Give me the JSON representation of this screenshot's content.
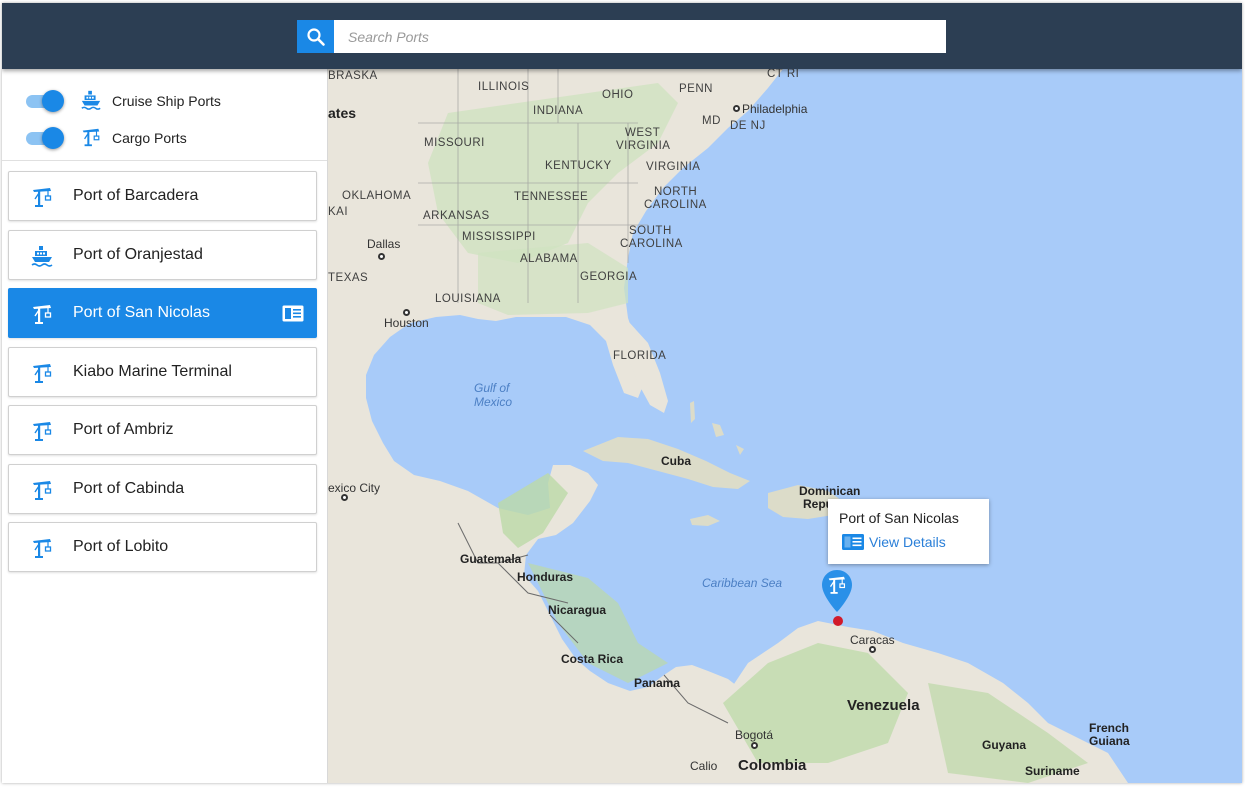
{
  "search": {
    "placeholder": "Search Ports"
  },
  "filters": [
    {
      "label": "Cruise Ship Ports",
      "enabled": true,
      "icon": "cruise-ship-icon"
    },
    {
      "label": "Cargo Ports",
      "enabled": true,
      "icon": "cargo-crane-icon"
    }
  ],
  "ports": [
    {
      "name": "Port of Barcadera",
      "type": "cargo",
      "active": false
    },
    {
      "name": "Port of Oranjestad",
      "type": "cruise",
      "active": false
    },
    {
      "name": "Port of San Nicolas",
      "type": "cargo",
      "active": true
    },
    {
      "name": "Kiabo Marine Terminal",
      "type": "cargo",
      "active": false
    },
    {
      "name": "Port of Ambriz",
      "type": "cargo",
      "active": false
    },
    {
      "name": "Port of Cabinda",
      "type": "cargo",
      "active": false
    },
    {
      "name": "Port of Lobito",
      "type": "cargo",
      "active": false
    }
  ],
  "infowindow": {
    "title": "Port of San Nicolas",
    "link": "View Details"
  },
  "map_labels": {
    "nebraska": "BRASKA",
    "illinois": "ILLINOIS",
    "indiana": "INDIANA",
    "ohio": "OHIO",
    "penn": "PENN",
    "ct_ri": "CT RI",
    "philadelphia": "Philadelphia",
    "md": "MD",
    "de_nj": "DE NJ",
    "ates": "ates",
    "missouri": "MISSOURI",
    "west_virginia_1": "WEST",
    "west_virginia_2": "VIRGINIA",
    "kentucky": "KENTUCKY",
    "virginia": "VIRGINIA",
    "oklahoma": "OKLAHOMA",
    "tennessee": "TENNESSEE",
    "north_carolina_1": "NORTH",
    "north_carolina_2": "CAROLINA",
    "kai": "KAI",
    "arkansas": "ARKANSAS",
    "dallas": "Dallas",
    "mississippi": "MISSISSIPPI",
    "south_carolina_1": "SOUTH",
    "south_carolina_2": "CAROLINA",
    "alabama": "ALABAMA",
    "texas": "TEXAS",
    "georgia": "GEORGIA",
    "louisiana": "LOUISIANA",
    "houston": "Houston",
    "florida": "FLORIDA",
    "gulf_1": "Gulf of",
    "gulf_2": "Mexico",
    "cuba": "Cuba",
    "exico_city": "exico City",
    "dominican_1": "Dominican",
    "dominican_2": "Repu",
    "guatemala": "Guatemala",
    "honduras": "Honduras",
    "caribbean": "Caribbean Sea",
    "nicaragua": "Nicaragua",
    "caracas": "Caracas",
    "costa_rica": "Costa Rica",
    "panama": "Panama",
    "venezuela": "Venezuela",
    "french_1": "French",
    "french_2": "Guiana",
    "bogota": "Bogotá",
    "guyana": "Guyana",
    "calio": "Calio",
    "colombia": "Colombia",
    "suriname": "Suriname"
  },
  "colors": {
    "header": "#2c3e53",
    "accent": "#1a88e6",
    "water": "#a8cbf9",
    "land": "#e9e5db",
    "marker": "#d11a2a"
  }
}
